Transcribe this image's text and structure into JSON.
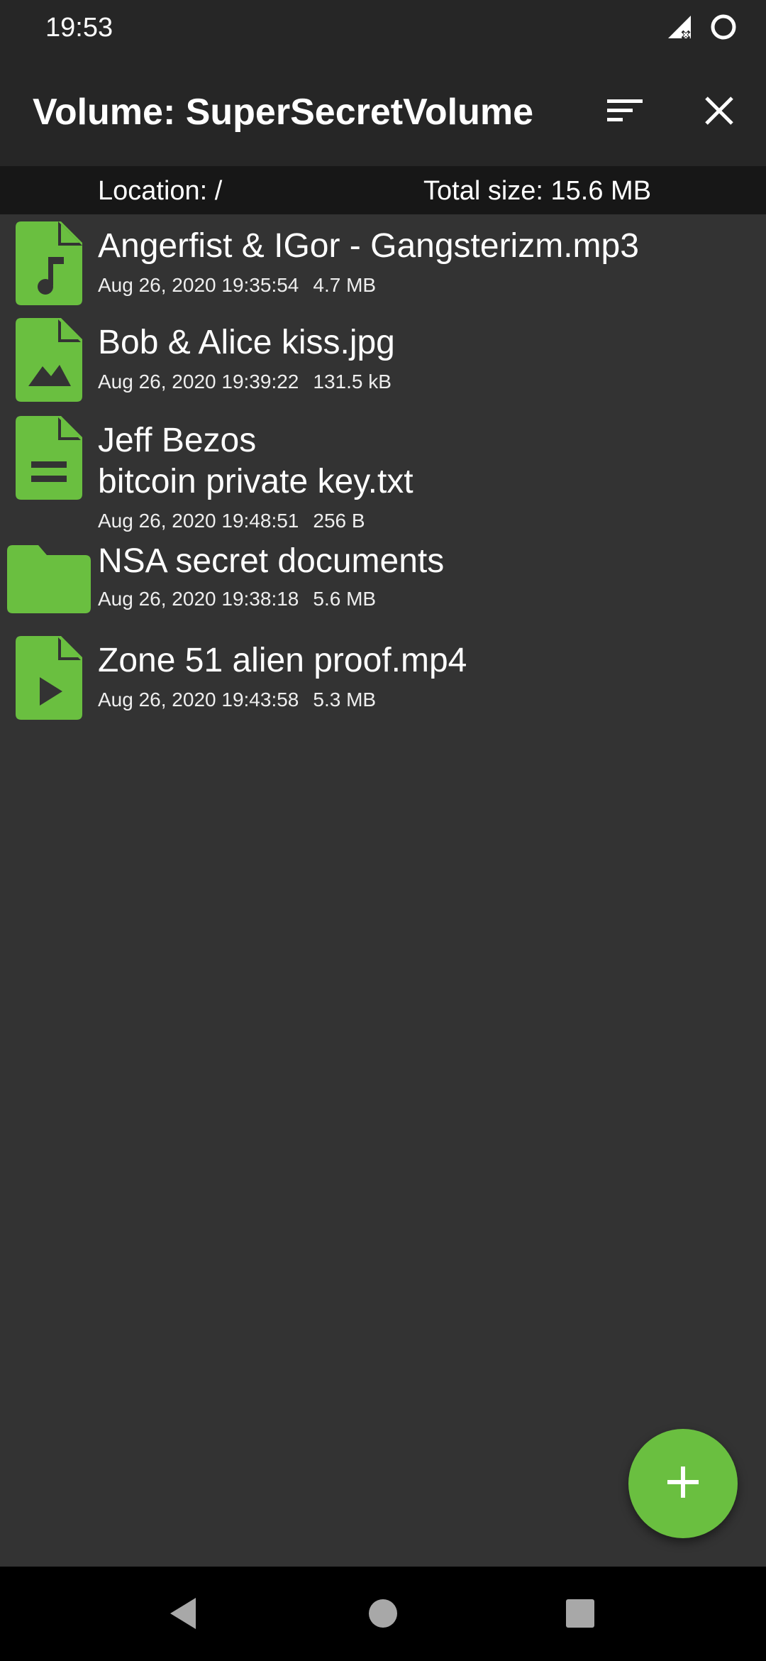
{
  "status_bar": {
    "time": "19:53",
    "icons": [
      "signal-off-icon",
      "circle-status-icon"
    ]
  },
  "app_bar": {
    "title": "Volume: SuperSecretVolume",
    "actions": [
      "sort-icon",
      "close-icon"
    ]
  },
  "info_bar": {
    "location": "Location: /",
    "total_size": "Total size: 15.6 MB"
  },
  "files": [
    {
      "name_lines": [
        "Angerfist & IGor - Gangsterizm.mp3"
      ],
      "date": "Aug 26, 2020 19:35:54",
      "size": "4.7 MB",
      "icon": "audio-file-icon"
    },
    {
      "name_lines": [
        "Bob & Alice kiss.jpg"
      ],
      "date": "Aug 26, 2020 19:39:22",
      "size": "131.5 kB",
      "icon": "image-file-icon"
    },
    {
      "name_lines": [
        "Jeff Bezos",
        "bitcoin private key.txt"
      ],
      "date": "Aug 26, 2020 19:48:51",
      "size": "256 B",
      "icon": "text-file-icon"
    },
    {
      "name_lines": [
        "NSA secret documents"
      ],
      "date": "Aug 26, 2020 19:38:18",
      "size": "5.6 MB",
      "icon": "folder-icon"
    },
    {
      "name_lines": [
        "Zone 51 alien proof.mp4"
      ],
      "date": "Aug 26, 2020 19:43:58",
      "size": "5.3 MB",
      "icon": "video-file-icon"
    }
  ],
  "fab": {
    "icon": "plus-icon"
  },
  "nav_bar": {
    "icons": [
      "back-icon",
      "home-icon",
      "recents-icon"
    ]
  },
  "colors": {
    "accent": "#6abf40",
    "background": "#333333",
    "app_bar": "#262626",
    "info_bar": "#171717",
    "nav_bar": "#000000"
  }
}
